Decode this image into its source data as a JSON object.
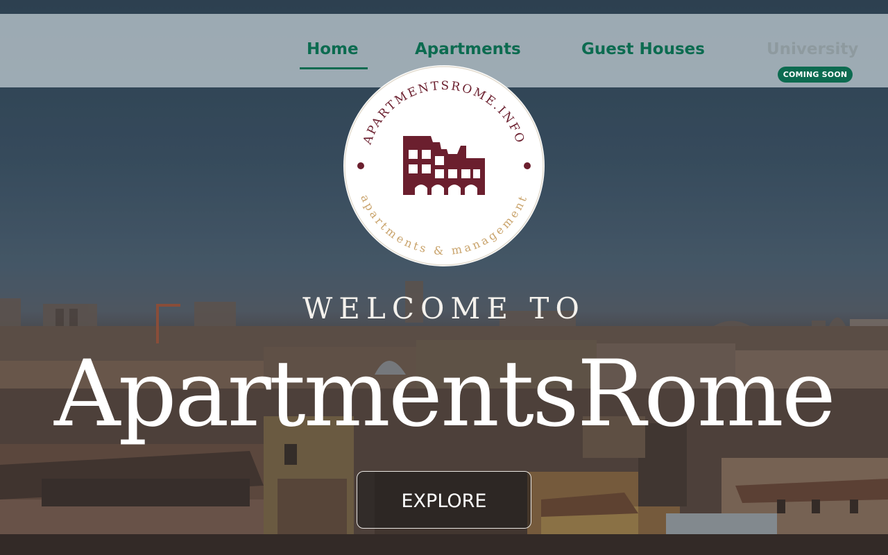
{
  "nav": {
    "items": [
      {
        "label": "Home",
        "active": true
      },
      {
        "label": "Apartments",
        "active": false
      },
      {
        "label": "Guest Houses",
        "active": false
      },
      {
        "label": "University",
        "active": false,
        "disabled": true
      }
    ],
    "badge": "COMING SOON"
  },
  "logo": {
    "top_text": "APARTMENTSROME.INFO",
    "bottom_text": "apartments & management",
    "icon": "colosseum-icon"
  },
  "hero": {
    "welcome": "WELCOME TO",
    "brand": "ApartmentsRome",
    "cta_label": "EXPLORE"
  },
  "colors": {
    "accent": "#0c6b50",
    "logo_maroon": "#6b1f2e",
    "logo_gold": "#c9a36b",
    "disabled": "#8e9a9f"
  }
}
